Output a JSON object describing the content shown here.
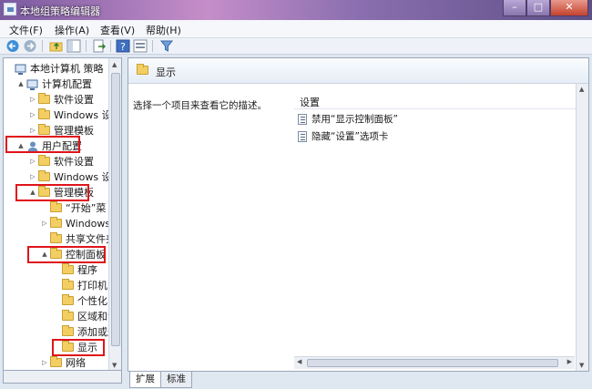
{
  "window": {
    "title": "本地组策略编辑器"
  },
  "menu": [
    "文件(F)",
    "操作(A)",
    "查看(V)",
    "帮助(H)"
  ],
  "tree": {
    "items": [
      {
        "label": "本地计算机 策略",
        "indent": 0,
        "arrow": "",
        "icon": "computer"
      },
      {
        "label": "计算机配置",
        "indent": 1,
        "arrow": "▲",
        "icon": "computer"
      },
      {
        "label": "软件设置",
        "indent": 2,
        "arrow": "▷",
        "icon": "folder"
      },
      {
        "label": "Windows 设置",
        "indent": 2,
        "arrow": "▷",
        "icon": "folder"
      },
      {
        "label": "管理模板",
        "indent": 2,
        "arrow": "▷",
        "icon": "folder"
      },
      {
        "label": "用户配置",
        "indent": 1,
        "arrow": "▲",
        "icon": "user"
      },
      {
        "label": "软件设置",
        "indent": 2,
        "arrow": "▷",
        "icon": "folder"
      },
      {
        "label": "Windows 设置",
        "indent": 2,
        "arrow": "▷",
        "icon": "folder"
      },
      {
        "label": "管理模板",
        "indent": 2,
        "arrow": "▲",
        "icon": "folder"
      },
      {
        "label": "“开始”菜",
        "indent": 3,
        "arrow": "",
        "icon": "folder"
      },
      {
        "label": "Windows 组",
        "indent": 3,
        "arrow": "▷",
        "icon": "folder"
      },
      {
        "label": "共享文件夹",
        "indent": 3,
        "arrow": "",
        "icon": "folder"
      },
      {
        "label": "控制面板",
        "indent": 3,
        "arrow": "▲",
        "icon": "folder"
      },
      {
        "label": "程序",
        "indent": 4,
        "arrow": "",
        "icon": "folder"
      },
      {
        "label": "打印机",
        "indent": 4,
        "arrow": "",
        "icon": "folder"
      },
      {
        "label": "个性化",
        "indent": 4,
        "arrow": "",
        "icon": "folder"
      },
      {
        "label": "区域和语",
        "indent": 4,
        "arrow": "",
        "icon": "folder"
      },
      {
        "label": "添加或删",
        "indent": 4,
        "arrow": "",
        "icon": "folder"
      },
      {
        "label": "显示",
        "indent": 4,
        "arrow": "",
        "icon": "folder"
      },
      {
        "label": "网络",
        "indent": 3,
        "arrow": "▷",
        "icon": "folder"
      }
    ]
  },
  "right": {
    "header_title": "显示",
    "description": "选择一个项目来查看它的描述。",
    "column_header": "设置",
    "settings": [
      "禁用“显示控制面板”",
      "隐藏“设置”选项卡"
    ]
  },
  "tabs": [
    "扩展",
    "标准"
  ],
  "colors": {
    "highlight": "#e0141a",
    "folder": "#f3cf63"
  }
}
